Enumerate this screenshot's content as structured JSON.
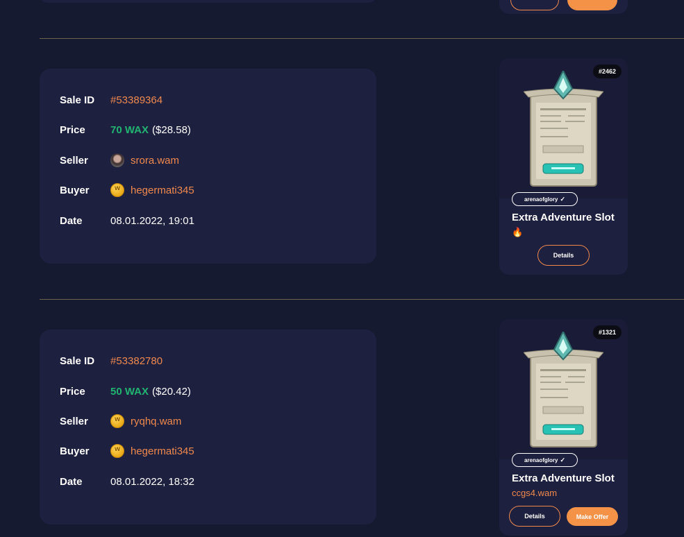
{
  "sales": [
    {
      "labels": {
        "sale_id": "Sale ID",
        "price": "Price",
        "seller": "Seller",
        "buyer": "Buyer",
        "date": "Date"
      },
      "sale_id": "#53389364",
      "price_wax": "70 WAX",
      "price_usd": "($28.58)",
      "seller": "srora.wam",
      "buyer": "hegermati345",
      "date": "08.01.2022, 19:01",
      "asset": {
        "mint": "#2462",
        "collection": "arenaofglory",
        "name": "Extra Adventure Slot",
        "sub": "🔥",
        "details_label": "Details"
      }
    },
    {
      "labels": {
        "sale_id": "Sale ID",
        "price": "Price",
        "seller": "Seller",
        "buyer": "Buyer",
        "date": "Date"
      },
      "sale_id": "#53382780",
      "price_wax": "50 WAX",
      "price_usd": "($20.42)",
      "seller": "ryqhq.wam",
      "buyer": "hegermati345",
      "date": "08.01.2022, 18:32",
      "asset": {
        "mint": "#1321",
        "collection": "arenaofglory",
        "name": "Extra Adventure Slot",
        "sub": "ccgs4.wam",
        "details_label": "Details",
        "offer_label": "Make Offer"
      }
    }
  ],
  "colors": {
    "accent": "#f0894c",
    "wax_green": "#21b471",
    "card_bg": "#1e2040",
    "page_bg": "#161a30"
  }
}
